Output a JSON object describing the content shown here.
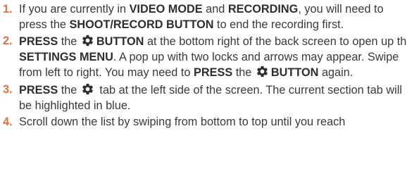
{
  "steps": [
    {
      "number": "1.",
      "t1": "If you are currently in ",
      "b1": "VIDEO MODE",
      "t2": " and ",
      "b2": "RECORDING",
      "t3": ", you will need to press the ",
      "b3": "SHOOT/RECORD BUTTON",
      "t4": " to end the recording first."
    },
    {
      "number": "2.",
      "b1": "PRESS",
      "t1": " the ",
      "icon": "gear-icon",
      "b2": "BUTTON",
      "t2": " at the bottom right of the back screen to open up the ",
      "b3": "SETTINGS MENU",
      "t3": ". A pop up with two locks and arrows may appear. Swipe from left to right. You may need to ",
      "b4": "PRESS",
      "t4": " the ",
      "icon2": "gear-icon",
      "b5": "BUTTON",
      "t5": " again."
    },
    {
      "number": "3.",
      "b1": "PRESS",
      "t1": " the ",
      "icon": "gear-icon",
      "t2": " tab at the left side of the screen. The current section tab will be highlighted in blue."
    },
    {
      "number": "4.",
      "t1": "Scroll down the list by swiping from bottom to top until you reach"
    }
  ],
  "colors": {
    "number": "#e8703c",
    "text": "#3a3a3a",
    "bold_text": "#2e2e2e",
    "icon": "#2e2e2e"
  }
}
